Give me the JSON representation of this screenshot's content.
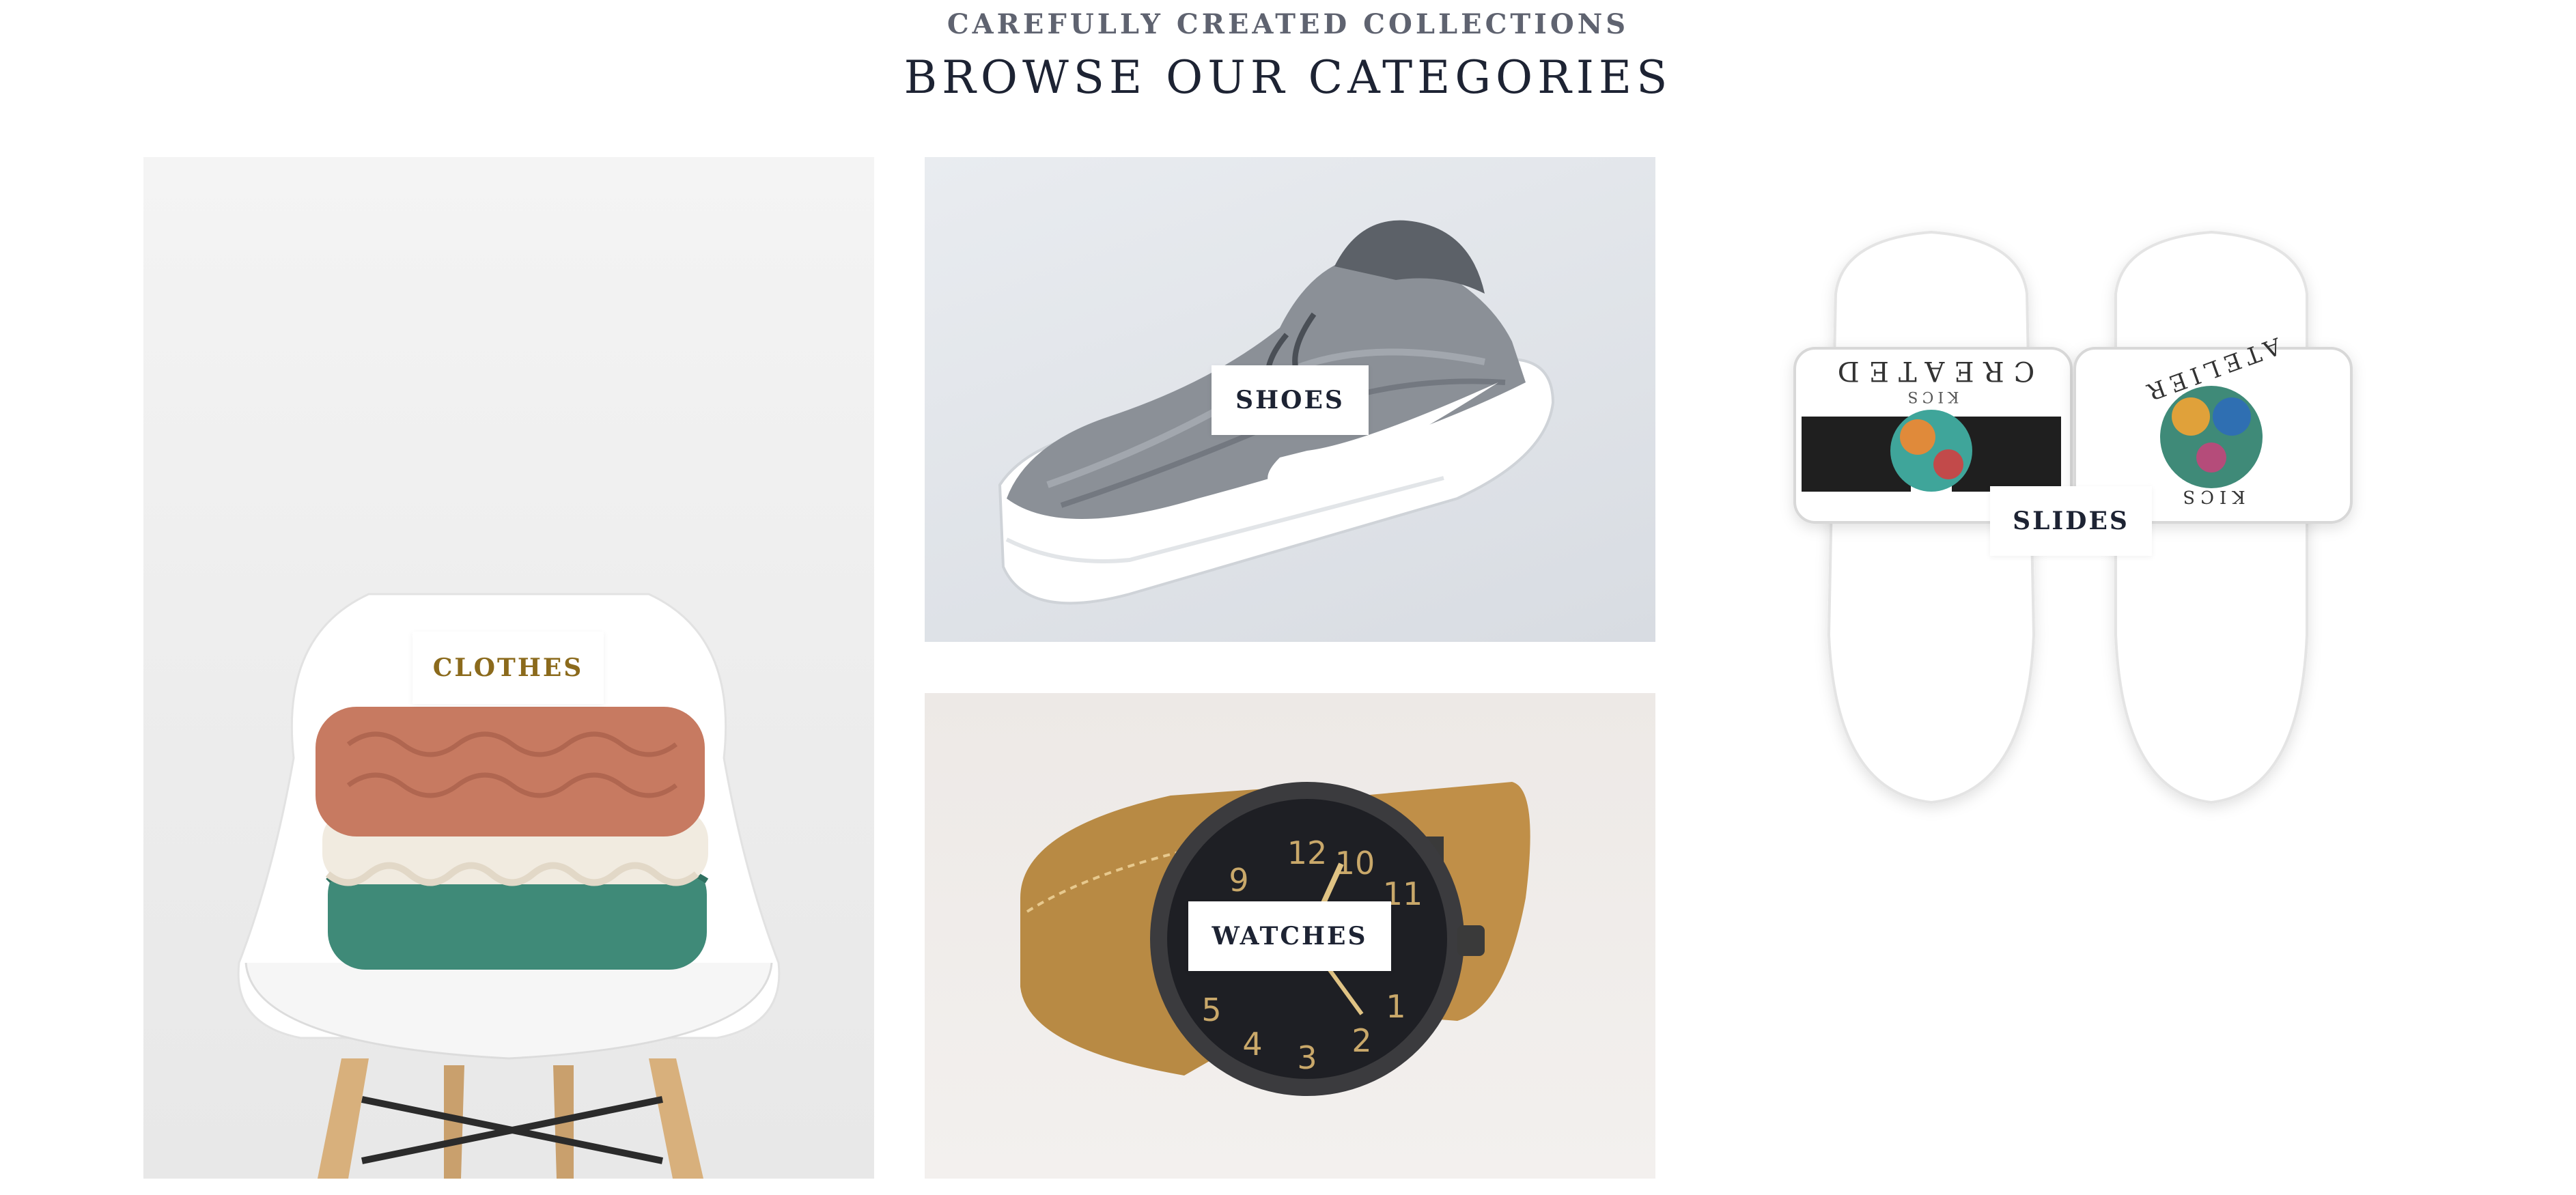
{
  "header": {
    "subtitle": "CAREFULLY CREATED COLLECTIONS",
    "title": "BROWSE OUR CATEGORIES"
  },
  "categories": [
    {
      "label": "CLOTHES",
      "label_color": "#8b6a1c"
    },
    {
      "label": "SHOES",
      "label_color": "#1d2333"
    },
    {
      "label": "WATCHES",
      "label_color": "#1d2333"
    },
    {
      "label": "SLIDES",
      "label_color": "#1d2333"
    }
  ],
  "slides_print": {
    "left_top": "CREATED",
    "left_small": "KICS",
    "right_top": "ATELIER",
    "right_bottom": "KICS"
  },
  "colors": {
    "heading": "#1d2333",
    "subheading": "#5f6370",
    "accent_label": "#8b6a1c"
  }
}
